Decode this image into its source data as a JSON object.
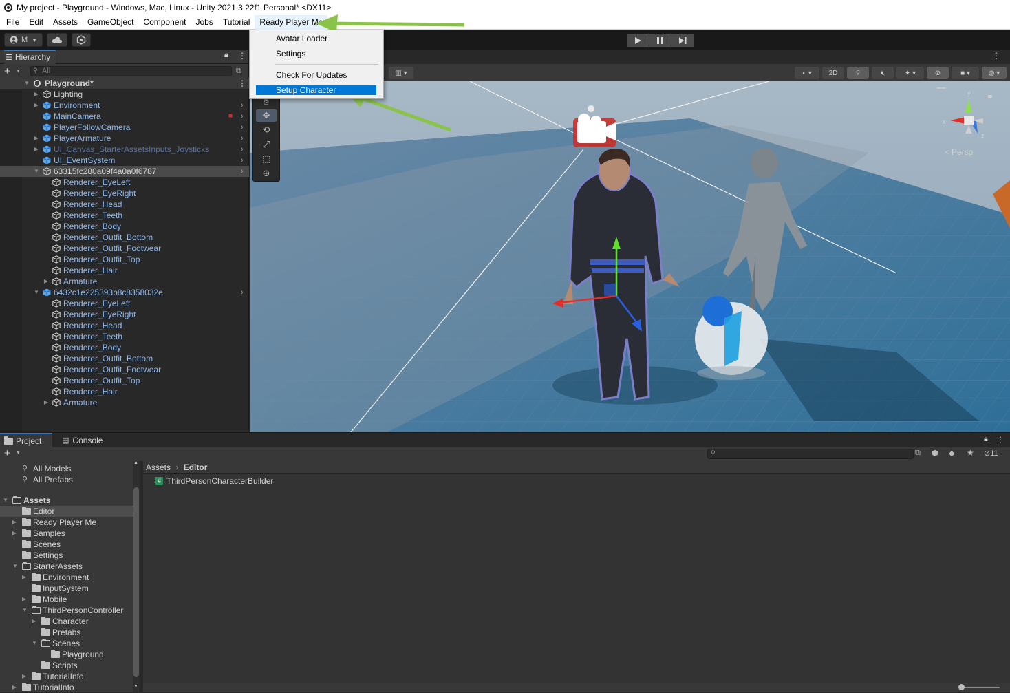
{
  "window": {
    "title": "My project - Playground - Windows, Mac, Linux - Unity 2021.3.22f1 Personal* <DX11>"
  },
  "menubar": [
    "File",
    "Edit",
    "Assets",
    "GameObject",
    "Component",
    "Jobs",
    "Tutorial",
    "Ready Player Me"
  ],
  "toolbar": {
    "account_label": "M"
  },
  "dropdown": {
    "items": [
      "Avatar Loader",
      "Settings",
      "Check For Updates",
      "Setup Character"
    ],
    "highlighted": "Setup Character",
    "highlight_color": "#0078d7"
  },
  "hierarchy": {
    "tab_label": "Hierarchy",
    "search_placeholder": "All",
    "scene_name": "Playground*",
    "rows": [
      "Lighting",
      "Environment",
      "MainCamera",
      "PlayerFollowCamera",
      "PlayerArmature",
      "UI_Canvas_StarterAssetsInputs_Joysticks",
      "UI_EventSystem",
      "63315fc280a09f4a0a0f6787",
      "Renderer_EyeLeft",
      "Renderer_EyeRight",
      "Renderer_Head",
      "Renderer_Teeth",
      "Renderer_Body",
      "Renderer_Outfit_Bottom",
      "Renderer_Outfit_Footwear",
      "Renderer_Outfit_Top",
      "Renderer_Hair",
      "Armature",
      "6432c1e225393b8c8358032e",
      "Renderer_EyeLeft",
      "Renderer_EyeRight",
      "Renderer_Head",
      "Renderer_Teeth",
      "Renderer_Body",
      "Renderer_Outfit_Bottom",
      "Renderer_Outfit_Footwear",
      "Renderer_Outfit_Top",
      "Renderer_Hair",
      "Armature"
    ]
  },
  "scene": {
    "toolbar_2d_label": "2D",
    "persp_label": "Persp",
    "gizmo_axes": {
      "x": "x",
      "y": "y",
      "z": "z"
    }
  },
  "project": {
    "tab_project": "Project",
    "tab_console": "Console",
    "hidden_count": "11",
    "favorites": [
      "All Models",
      "All Prefabs"
    ],
    "tree": [
      "Assets",
      "Editor",
      "Ready Player Me",
      "Samples",
      "Scenes",
      "Settings",
      "StarterAssets",
      "Environment",
      "InputSystem",
      "Mobile",
      "ThirdPersonController",
      "Character",
      "Prefabs",
      "Scenes",
      "Playground",
      "Scripts",
      "TutorialInfo",
      "TutorialInfo"
    ],
    "breadcrumb": [
      "Assets",
      "Editor"
    ],
    "files": [
      "ThirdPersonCharacterBuilder"
    ]
  },
  "annotation_color": "#8bc34a"
}
